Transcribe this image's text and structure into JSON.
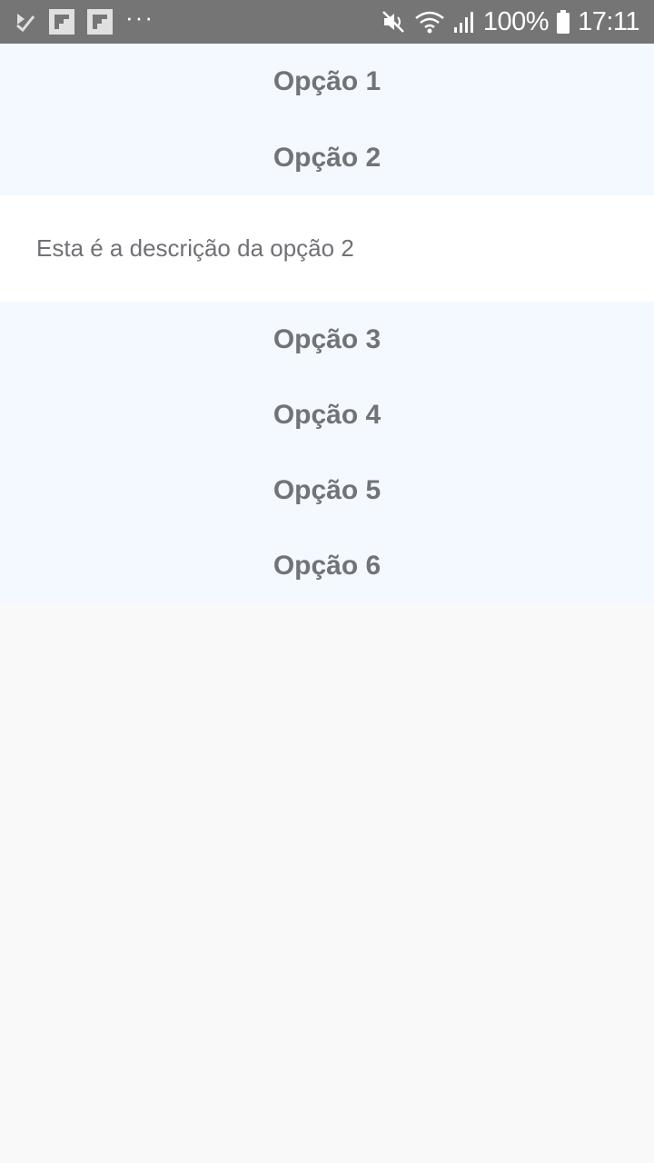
{
  "status_bar": {
    "battery_text": "100%",
    "time": "17:11",
    "overflow_dots": "···",
    "left_icons": [
      "checkbox-icon",
      "flipboard-icon",
      "flipboard-icon"
    ],
    "right_icons": [
      "mute-icon",
      "wifi-icon",
      "signal-icon",
      "battery-icon"
    ]
  },
  "accordion": {
    "options": [
      {
        "label": "Opção 1"
      },
      {
        "label": "Opção 2",
        "expanded": true,
        "description": "Esta é a descrição da opção 2"
      },
      {
        "label": "Opção 3"
      },
      {
        "label": "Opção 4"
      },
      {
        "label": "Opção 5"
      },
      {
        "label": "Opção 6"
      }
    ]
  },
  "colors": {
    "status_bar_bg": "#757575",
    "option_bg": "#f3f9fe",
    "option_text": "#717378",
    "description_bg": "#ffffff",
    "page_bg": "#f9f9f9"
  }
}
